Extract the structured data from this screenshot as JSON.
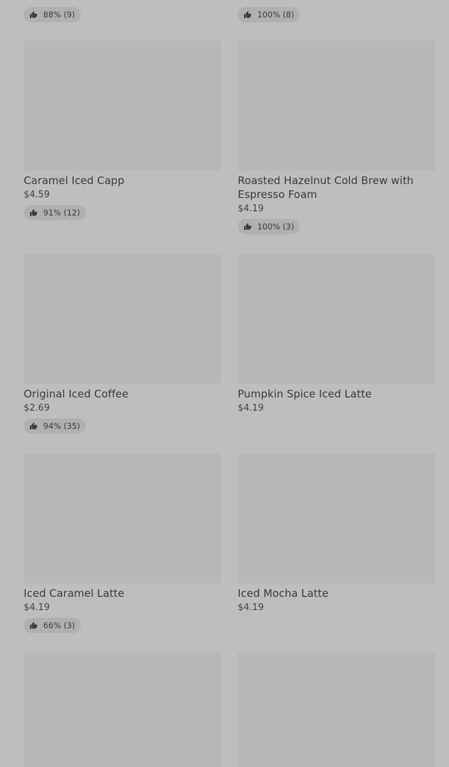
{
  "top_row": [
    {
      "rating": "88% (9)"
    },
    {
      "rating": "100% (8)"
    }
  ],
  "items": [
    {
      "name": "Caramel Iced Capp",
      "price": "$4.59",
      "rating": "91% (12)"
    },
    {
      "name": "Roasted Hazelnut Cold Brew with Espresso Foam",
      "price": "$4.19",
      "rating": "100% (3)"
    },
    {
      "name": "Original Iced Coffee",
      "price": "$2.69",
      "rating": "94% (35)"
    },
    {
      "name": "Pumpkin Spice Iced Latte",
      "price": "$4.19",
      "rating": null
    },
    {
      "name": "Iced Caramel Latte",
      "price": "$4.19",
      "rating": "66% (3)"
    },
    {
      "name": "Iced Mocha Latte",
      "price": "$4.19",
      "rating": null
    }
  ],
  "icons": {
    "rating": "thumbs-up-icon"
  },
  "colors": {
    "background": "#bdbdbd",
    "image_placeholder": "#b7b7b7",
    "rating_pill": "#b0b0b0",
    "text": "#3c3c3c"
  }
}
